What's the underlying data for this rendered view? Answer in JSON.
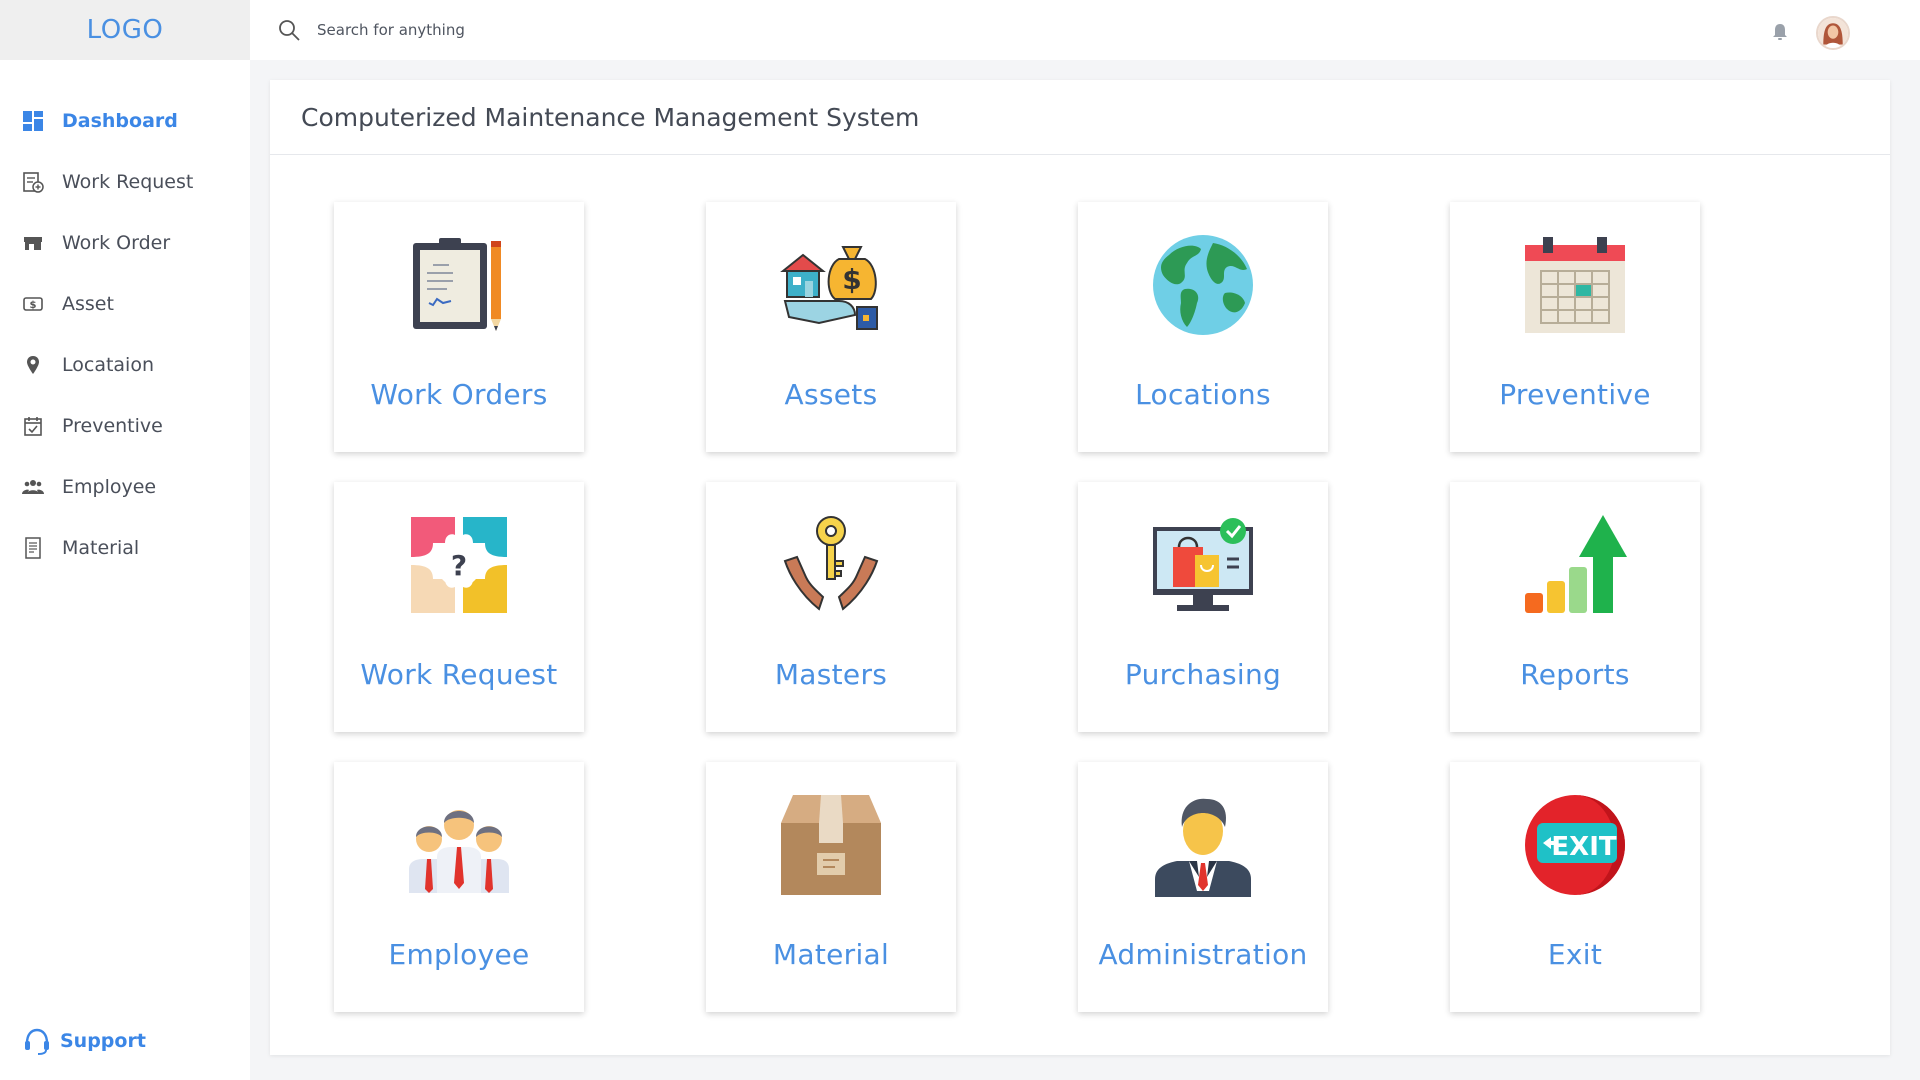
{
  "logo": {
    "text": "LOGO"
  },
  "search": {
    "placeholder": "Search for anything"
  },
  "sidebar": {
    "items": [
      {
        "label": "Dashboard",
        "icon": "dashboard-icon",
        "active": true
      },
      {
        "label": "Work Request",
        "icon": "work-request-icon"
      },
      {
        "label": "Work Order",
        "icon": "work-order-icon"
      },
      {
        "label": "Asset",
        "icon": "asset-icon"
      },
      {
        "label": "Locataion",
        "icon": "location-pin-icon"
      },
      {
        "label": "Preventive",
        "icon": "calendar-check-icon"
      },
      {
        "label": "Employee",
        "icon": "people-icon"
      },
      {
        "label": "Material",
        "icon": "document-icon"
      }
    ],
    "support": {
      "label": "Support",
      "icon": "headset-icon"
    }
  },
  "topbar": {
    "icons": [
      "search-icon",
      "bell-icon",
      "avatar"
    ]
  },
  "panel": {
    "title": "Computerized Maintenance Management System",
    "tiles": [
      {
        "label": "Work Orders",
        "icon": "clipboard-icon"
      },
      {
        "label": "Assets",
        "icon": "money-house-hand-icon"
      },
      {
        "label": "Locations",
        "icon": "globe-icon"
      },
      {
        "label": "Preventive",
        "icon": "calendar-icon"
      },
      {
        "label": "Work Request",
        "icon": "question-puzzle-icon"
      },
      {
        "label": "Masters",
        "icon": "key-hands-icon"
      },
      {
        "label": "Purchasing",
        "icon": "shopping-monitor-icon"
      },
      {
        "label": "Reports",
        "icon": "growth-chart-icon"
      },
      {
        "label": "Employee",
        "icon": "team-icon"
      },
      {
        "label": "Material",
        "icon": "box-icon"
      },
      {
        "label": "Administration",
        "icon": "businessman-icon"
      },
      {
        "label": "Exit",
        "icon": "exit-sign-icon"
      }
    ]
  },
  "colors": {
    "accent": "#4a90e2",
    "active_nav": "#3b86e6",
    "background": "#f4f5f7"
  }
}
